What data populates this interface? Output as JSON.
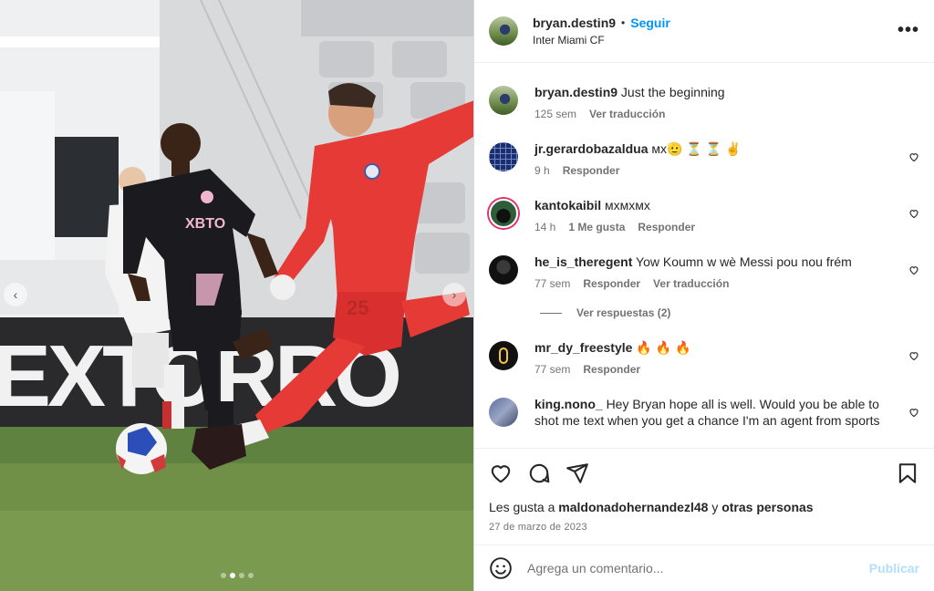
{
  "post": {
    "author": "bryan.destin9",
    "separator": "•",
    "follow_label": "Seguir",
    "location": "Inter Miami CF",
    "more_label": "•••",
    "carousel": {
      "slide_count": 4,
      "active_index": 1
    }
  },
  "comments": [
    {
      "user": "bryan.destin9",
      "text": "Just the beginning",
      "time": "125 sem",
      "actions": [
        "Ver traducción"
      ],
      "likes": ""
    },
    {
      "user": "jr.gerardobazaldua",
      "text": "ᴍx🫡 ⏳ ⏳ ✌️",
      "time": "9 h",
      "actions": [
        "Responder"
      ],
      "likes": ""
    },
    {
      "user": "kantokaibil",
      "text": "ᴍxᴍxᴍx",
      "time": "14 h",
      "likes": "1 Me gusta",
      "actions": [
        "Responder"
      ]
    },
    {
      "user": "he_is_theregent",
      "text": "Yow Koumn w wè Messi pou nou frém",
      "time": "77 sem",
      "actions": [
        "Responder",
        "Ver traducción"
      ],
      "likes": "",
      "replies": "Ver respuestas (2)"
    },
    {
      "user": "mr_dy_freestyle",
      "text": "🔥 🔥 🔥",
      "time": "77 sem",
      "actions": [
        "Responder"
      ],
      "likes": ""
    },
    {
      "user": "king.nono_",
      "text": "Hey Bryan hope all is well. Would you be able to shot me text when you get a chance I'm an agent from sports",
      "time": "",
      "actions": [],
      "likes": ""
    }
  ],
  "footer": {
    "likes_prefix": "Les gusta a",
    "likes_user": "maldonadohernandezl48",
    "likes_connector": "y",
    "likes_others": "otras personas",
    "date": "27 de marzo de 2023"
  },
  "composer": {
    "placeholder": "Agrega un comentario...",
    "publish_label": "Publicar"
  },
  "colors": {
    "accent": "#0095f6",
    "publish_disabled": "#b2dffc",
    "text": "#262626",
    "muted": "#737373"
  }
}
